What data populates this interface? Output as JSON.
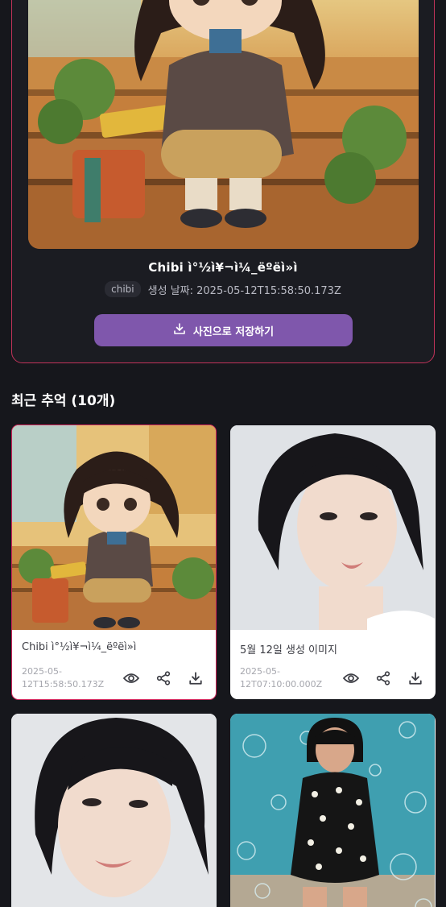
{
  "featured": {
    "title": "Chibi ì°½ì¥¬ì¼_ëºëì»ì",
    "tag": "chibi",
    "date_text": "생성 날짜: 2025-05-12T15:58:50.173Z",
    "save_label": "사진으로 저장하기",
    "image_icon": "chibi-girl-illustration"
  },
  "section": {
    "title": "최근 추억 (10개)"
  },
  "cards": [
    {
      "title": "Chibi ì°½ì¥¬ì¼_ëºëì»ì",
      "date": "2025-05-12T15:58:50.173Z",
      "image": "chibi-girl-illustration"
    },
    {
      "title": "5월 12일 생성 이미지",
      "date": "2025-05-12T07:10:00.000Z",
      "image": "woman-portrait"
    },
    {
      "title": "",
      "date": "",
      "image": "woman-portrait"
    },
    {
      "title": "",
      "date": "",
      "image": "woman-bubbles-photo"
    }
  ],
  "colors": {
    "accent": "#7f57ac",
    "highlight_border": "#c2335a",
    "background": "#16171c"
  }
}
